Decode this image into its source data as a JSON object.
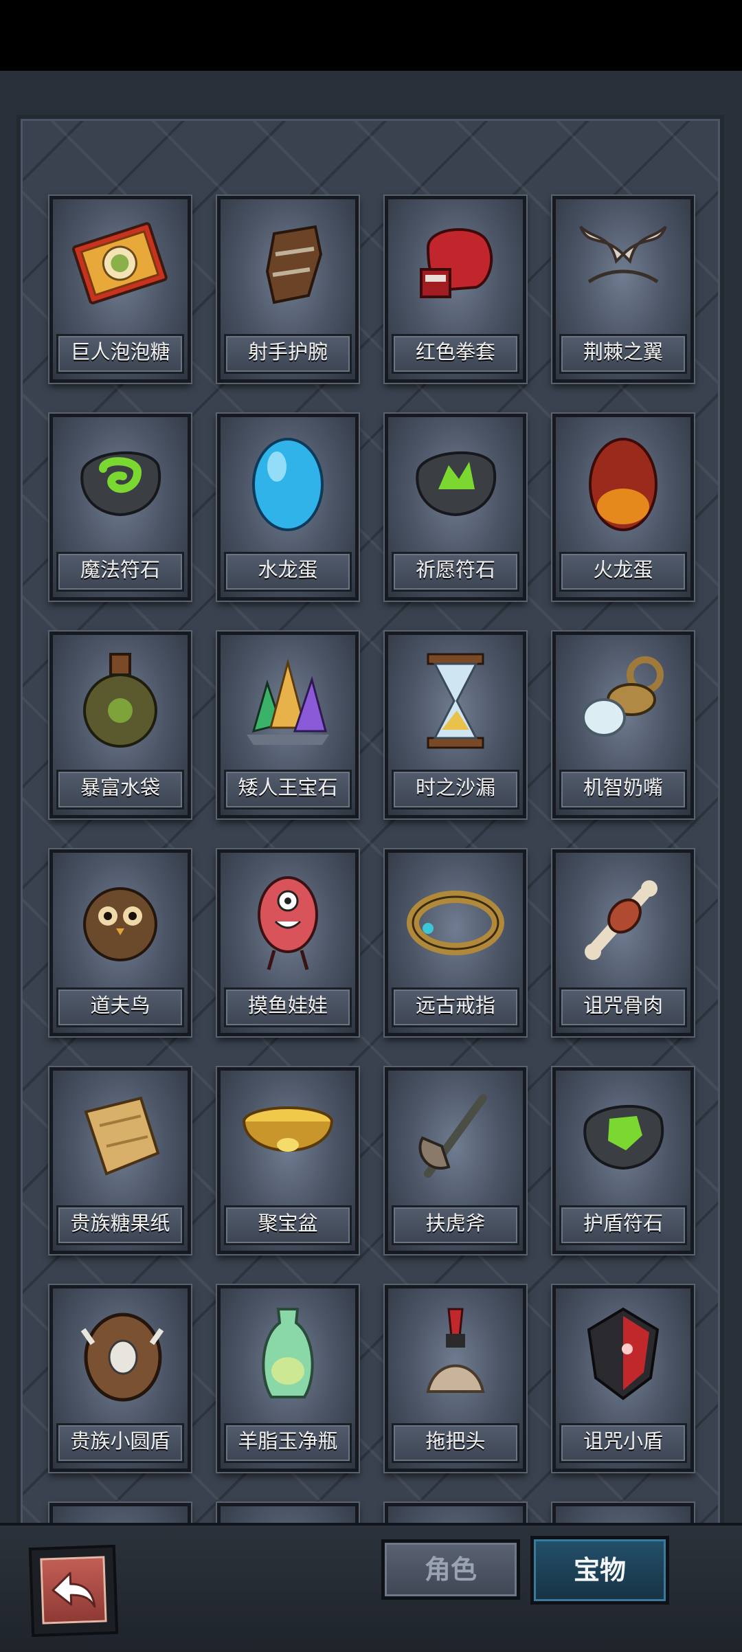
{
  "items": [
    {
      "name": "巨人泡泡糖",
      "icon": "gum-box-icon"
    },
    {
      "name": "射手护腕",
      "icon": "bracer-icon"
    },
    {
      "name": "红色拳套",
      "icon": "boxing-glove-icon"
    },
    {
      "name": "荆棘之翼",
      "icon": "thorn-wings-icon"
    },
    {
      "name": "魔法符石",
      "icon": "magic-rune-stone-icon"
    },
    {
      "name": "水龙蛋",
      "icon": "water-dragon-egg-icon"
    },
    {
      "name": "祈愿符石",
      "icon": "wish-rune-stone-icon"
    },
    {
      "name": "火龙蛋",
      "icon": "fire-dragon-egg-icon"
    },
    {
      "name": "暴富水袋",
      "icon": "water-flask-icon"
    },
    {
      "name": "矮人王宝石",
      "icon": "crystal-gems-icon"
    },
    {
      "name": "时之沙漏",
      "icon": "hourglass-icon"
    },
    {
      "name": "机智奶嘴",
      "icon": "pacifier-icon"
    },
    {
      "name": "道夫鸟",
      "icon": "owl-icon"
    },
    {
      "name": "摸鱼娃娃",
      "icon": "red-doll-icon"
    },
    {
      "name": "远古戒指",
      "icon": "ancient-ring-icon"
    },
    {
      "name": "诅咒骨肉",
      "icon": "bone-meat-icon"
    },
    {
      "name": "贵族糖果纸",
      "icon": "candy-paper-icon"
    },
    {
      "name": "聚宝盆",
      "icon": "treasure-bowl-icon"
    },
    {
      "name": "扶虎斧",
      "icon": "axe-icon"
    },
    {
      "name": "护盾符石",
      "icon": "shield-rune-stone-icon"
    },
    {
      "name": "贵族小圆盾",
      "icon": "round-shield-icon"
    },
    {
      "name": "羊脂玉净瓶",
      "icon": "jade-vase-icon"
    },
    {
      "name": "拖把头",
      "icon": "mop-head-icon"
    },
    {
      "name": "诅咒小盾",
      "icon": "cursed-shield-icon"
    },
    {
      "name": "",
      "icon": "scroll-icon"
    },
    {
      "name": "",
      "icon": "knit-hat-icon"
    },
    {
      "name": "",
      "icon": "star-book-icon"
    },
    {
      "name": "",
      "icon": "white-wings-icon"
    }
  ],
  "tabs": {
    "role": "角色",
    "treasure": "宝物",
    "active": "treasure"
  },
  "back_button": {
    "icon": "back-arrow-icon"
  }
}
